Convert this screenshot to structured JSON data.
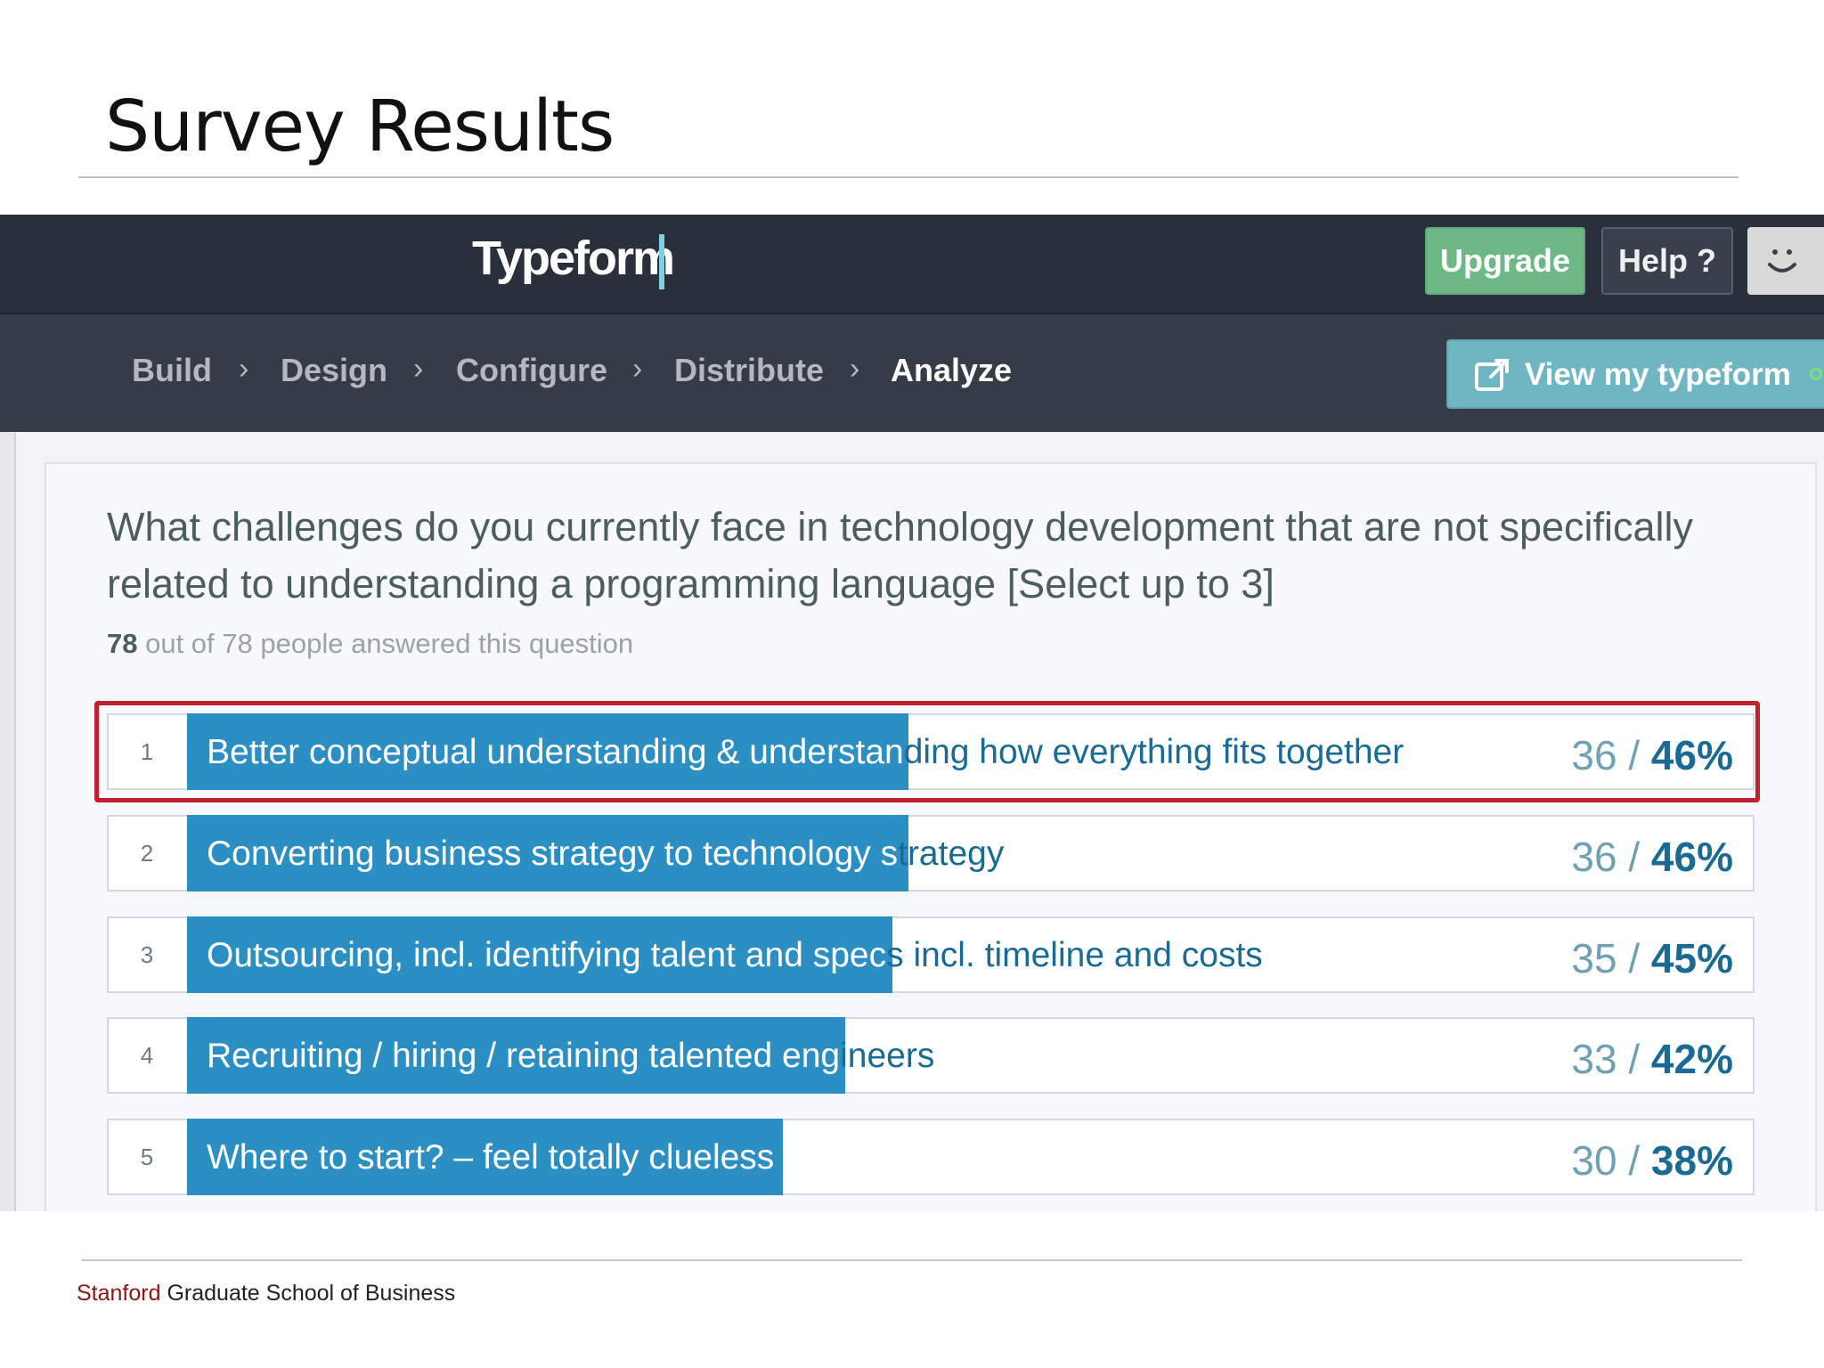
{
  "slide": {
    "title": "Survey Results",
    "footer_brand": "Stanford",
    "footer_rest": " Graduate School of Business"
  },
  "app": {
    "logo": "Typeform",
    "upgrade_label": "Upgrade",
    "help_label": "Help ?",
    "avatar_icon": "smiley-icon",
    "nav": {
      "build": "Build",
      "design": "Design",
      "configure": "Configure",
      "distribute": "Distribute",
      "analyze": "Analyze",
      "separator": "›"
    },
    "view_label": "View my typeform"
  },
  "question": {
    "text": "What challenges do you currently face in technology development that are not specifically related to understanding a programming language  [Select up to 3]",
    "answered_count": "78",
    "answered_rest": " out of 78 people answered this question"
  },
  "answers": [
    {
      "num": "1",
      "inside": "Better conceptual understanding & understan",
      "outside": "ding how everything fits together",
      "count": "36",
      "percent": "46%",
      "fraction": 0.46
    },
    {
      "num": "2",
      "inside": "Converting business strategy to technology s",
      "outside": "trategy",
      "count": "36",
      "percent": "46%",
      "fraction": 0.46
    },
    {
      "num": "3",
      "inside": "Outsourcing, incl. identifying talent and spec",
      "outside": "s incl. timeline and costs",
      "count": "35",
      "percent": "45%",
      "fraction": 0.45
    },
    {
      "num": "4",
      "inside": "Recruiting / hiring / retaining talented eng",
      "outside": "ineers",
      "count": "33",
      "percent": "42%",
      "fraction": 0.42
    },
    {
      "num": "5",
      "inside": "Where to start? – feel totally clueless",
      "outside": "",
      "count": "30",
      "percent": "38%",
      "fraction": 0.38
    }
  ],
  "colors": {
    "bar": "#2c8fc4",
    "highlight": "#c41f2f",
    "upgrade": "#6db884",
    "brand": "#8c1515"
  }
}
